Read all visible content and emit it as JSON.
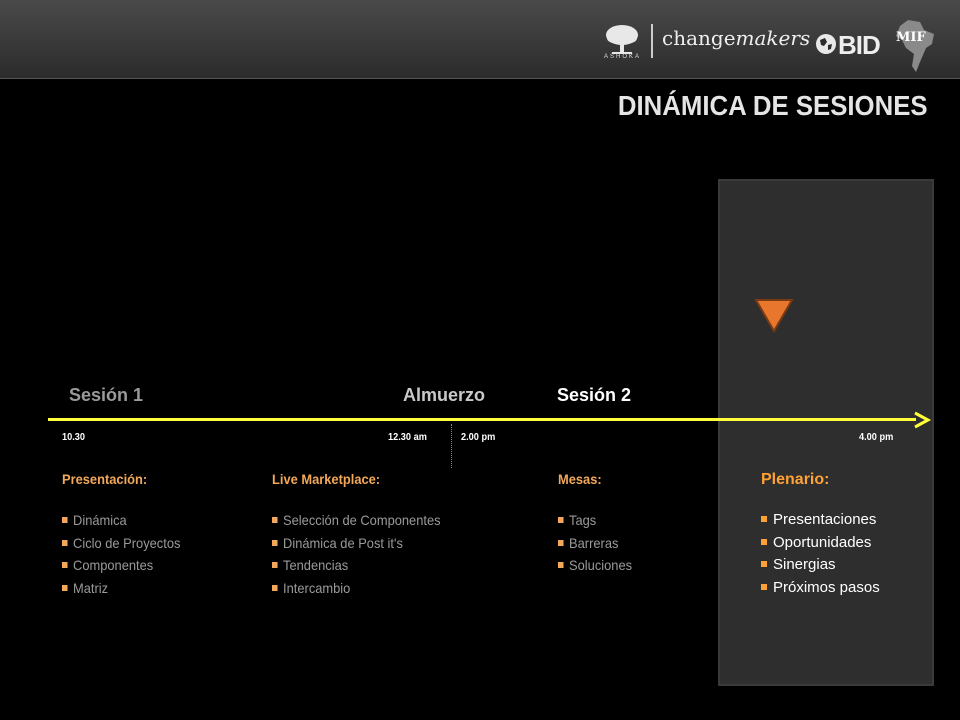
{
  "header": {
    "logos": {
      "ashoka": "ASHOKA",
      "changemakers_a": "change",
      "changemakers_b": "makers",
      "bid": "BID",
      "mif": "MIF"
    },
    "title": "DINÁMICA DE SESIONES"
  },
  "timeline": {
    "sessions": [
      {
        "label": "Sesión 1",
        "color": "#9a9a9a"
      },
      {
        "label": "Almuerzo",
        "color": "#c9c9c9"
      },
      {
        "label": "Sesión 2",
        "color": "#ffffff"
      }
    ],
    "times": [
      "10.30",
      "12.30 am",
      "2.00 pm",
      "4.00 pm"
    ],
    "line_color": "#ffff3a",
    "marker_color": "#e8762c"
  },
  "columns": [
    {
      "heading": "Presentación:",
      "items": [
        "Dinámica",
        "Ciclo de Proyectos",
        "Componentes",
        "Matriz"
      ]
    },
    {
      "heading": "Live Marketplace:",
      "items": [
        "Selección de Componentes",
        "Dinámica de Post it's",
        "Tendencias",
        "Intercambio"
      ]
    },
    {
      "heading": "Mesas:",
      "items": [
        "Tags",
        "Barreras",
        "Soluciones"
      ]
    },
    {
      "heading": "Plenario:",
      "items": [
        "Presentaciones",
        "Oportunidades",
        "Sinergias",
        "Próximos pasos"
      ]
    }
  ],
  "icons": [
    "tree-icon",
    "globe-icon",
    "map-icon",
    "triangle-down-icon",
    "arrow-right-icon"
  ]
}
